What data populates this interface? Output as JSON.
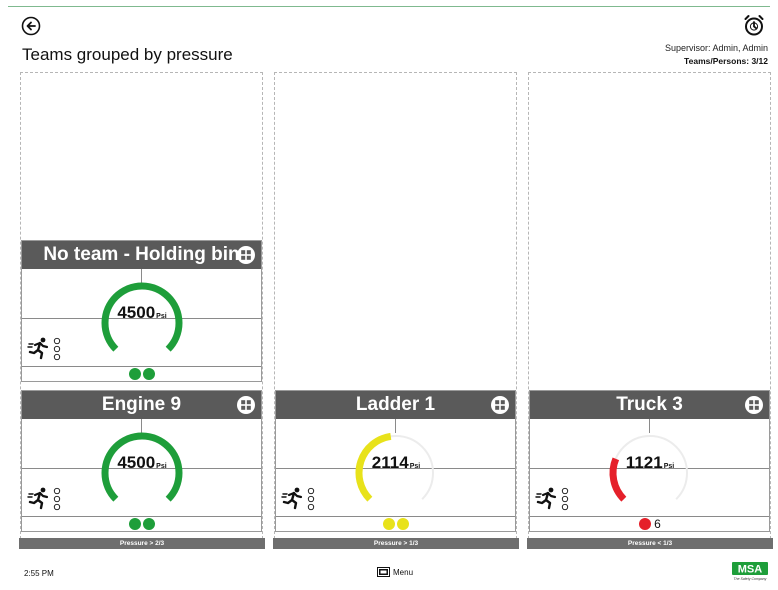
{
  "header": {
    "title": "Teams grouped by pressure",
    "supervisor": "Supervisor: Admin, Admin",
    "teams_persons": "Teams/Persons: 3/12"
  },
  "columns": [
    {
      "footer": "Pressure > 2/3"
    },
    {
      "footer": "Pressure > 1/3"
    },
    {
      "footer": "Pressure < 1/3"
    }
  ],
  "cards": [
    {
      "title": "No team - Holding bin",
      "value": "4500",
      "unit": "Psi",
      "fill": 1.0,
      "color": "#1e9e3a",
      "dots": 2,
      "dot_count": ""
    },
    {
      "title": "Engine 9",
      "value": "4500",
      "unit": "Psi",
      "fill": 1.0,
      "color": "#1e9e3a",
      "dots": 2,
      "dot_count": ""
    },
    {
      "title": "Ladder 1",
      "value": "2114",
      "unit": "Psi",
      "fill": 0.47,
      "color": "#e8e21a",
      "dots": 2,
      "dot_count": ""
    },
    {
      "title": "Truck 3",
      "value": "1121",
      "unit": "Psi",
      "fill": 0.25,
      "color": "#e5202a",
      "dots": 1,
      "dot_count": "6"
    }
  ],
  "footer": {
    "time": "2:55 PM",
    "menu_label": "Menu",
    "logo_text": "MSA",
    "logo_tagline": "The Safety Company"
  },
  "icons": {
    "back": "back-arrow-icon",
    "timer": "timer-icon",
    "grid": "grid-icon",
    "runner": "running-person-icon",
    "menu": "menu-icon"
  }
}
